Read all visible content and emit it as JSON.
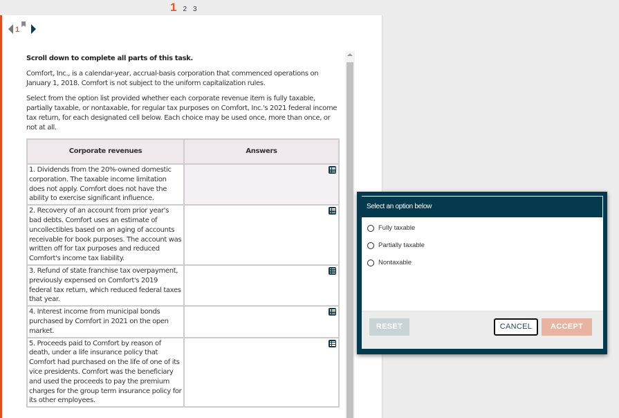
{
  "page_tabs": [
    {
      "label": "1",
      "active": true
    },
    {
      "label": "2",
      "active": false
    },
    {
      "label": "3",
      "active": false
    }
  ],
  "nav": {
    "current": "1"
  },
  "task": {
    "instruction": "Scroll down to complete all parts of this task.",
    "paragraph1": "Comfort, Inc., is a calendar-year, accrual-basis corporation that commenced operations on January 1, 2018. Comfort is not subject to the uniform capitalization rules.",
    "paragraph2": "Select from the option list provided whether each corporate revenue item is fully taxable, partially taxable, or nontaxable, for regular tax purposes on Comfort, Inc.'s 2021 federal income tax return, for each designated cell below. Each choice may be used once, more than once, or not at all."
  },
  "table": {
    "headers": [
      "Corporate revenues",
      "Answers"
    ],
    "rows": [
      {
        "item": "1. Dividends from the 20%-owned domestic corporation. The taxable income limitation does not apply. Comfort does not have the ability to exercise significant influence.",
        "answer": ""
      },
      {
        "item": "2. Recovery of an account from prior year's bad debts. Comfort uses an estimate of uncollectibles based on an aging of accounts receivable for book purposes. The account was written off for tax purposes and reduced Comfort's income tax liability.",
        "answer": ""
      },
      {
        "item": "3. Refund of state franchise tax overpayment, previously expensed on Comfort's 2019 federal tax return, which reduced federal taxes that year.",
        "answer": ""
      },
      {
        "item": "4. Interest income from municipal bonds purchased by Comfort in 2021 on the open market.",
        "answer": ""
      },
      {
        "item": "5. Proceeds paid to Comfort by reason of death, under a life insurance policy that Comfort had purchased on the life of one of its vice presidents. Comfort was the beneficiary and used the proceeds to pay the premium charges for the group term insurance policy for its other employees.",
        "answer": ""
      }
    ]
  },
  "dialog": {
    "title": "Select an option below",
    "options": [
      "Fully taxable",
      "Partially taxable",
      "Nontaxable"
    ],
    "buttons": {
      "reset": "RESET",
      "cancel": "CANCEL",
      "accept": "ACCEPT"
    }
  },
  "colors": {
    "accent": "#e35a2b",
    "navy": "#053a4e",
    "accept_disabled": "#e8b3a1",
    "reset_disabled": "#c8d3d6"
  }
}
